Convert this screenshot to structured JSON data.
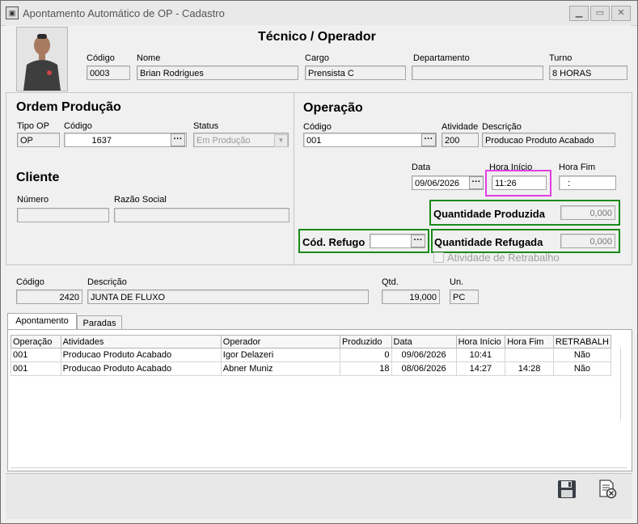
{
  "window": {
    "title": "Apontamento Automático de OP - Cadastro",
    "controls": {
      "minimize": "▁",
      "maximize": "▭",
      "close": "✕"
    }
  },
  "operator": {
    "heading": "Técnico / Operador",
    "codigo_label": "Código",
    "codigo": "0003",
    "nome_label": "Nome",
    "nome": "Brian Rodrigues",
    "cargo_label": "Cargo",
    "cargo": "Prensista C",
    "departamento_label": "Departamento",
    "departamento": "",
    "turno_label": "Turno",
    "turno": "8 HORAS"
  },
  "ordem": {
    "heading": "Ordem Produção",
    "tipo_label": "Tipo OP",
    "tipo": "OP",
    "codigo_label": "Código",
    "codigo": "1637",
    "status_label": "Status",
    "status": "Em Produção"
  },
  "cliente": {
    "heading": "Cliente",
    "numero_label": "Número",
    "numero": "",
    "razao_label": "Razão Social",
    "razao": ""
  },
  "operacao": {
    "heading": "Operação",
    "codigo_label": "Código",
    "codigo": "001",
    "atividade_label": "Atividade",
    "atividade": "200",
    "descricao_label": "Descrição",
    "descricao": "Producao Produto Acabado",
    "data_label": "Data",
    "data": "09/06/2026",
    "hora_inicio_label": "Hora Início",
    "hora_inicio": "11:26",
    "hora_fim_label": "Hora Fim",
    "hora_fim": ":",
    "qtd_produzida_label": "Quantidade Produzida",
    "qtd_produzida": "0,000",
    "qtd_refugada_label": "Quantidade Refugada",
    "qtd_refugada": "0,000",
    "cod_refugo_label": "Cód. Refugo",
    "cod_refugo": "",
    "retrabalho_label": "Atividade de Retrabalho"
  },
  "produto": {
    "codigo_label": "Código",
    "codigo": "2420",
    "descricao_label": "Descrição",
    "descricao": "JUNTA DE FLUXO",
    "qtd_label": "Qtd.",
    "qtd": "19,000",
    "un_label": "Un.",
    "un": "PC"
  },
  "tabs": [
    "Apontamento",
    "Paradas"
  ],
  "table": {
    "headers": [
      "Operação",
      "Atividades",
      "Operador",
      "Produzido",
      "Data",
      "Hora Início",
      "Hora Fim",
      "RETRABALH"
    ],
    "rows": [
      [
        "001",
        "Producao Produto Acabado",
        "Igor Delazeri",
        "0",
        "09/06/2026",
        "10:41",
        "",
        "Não"
      ],
      [
        "001",
        "Producao Produto Acabado",
        "Abner Muniz",
        "18",
        "08/06/2026",
        "14:27",
        "14:28",
        "Não"
      ]
    ]
  },
  "icons": {
    "save": "save-icon",
    "cancel": "cancel-document-icon"
  },
  "colors": {
    "highlight_green": "#1a8a1a",
    "highlight_magenta": "#e040e0"
  }
}
